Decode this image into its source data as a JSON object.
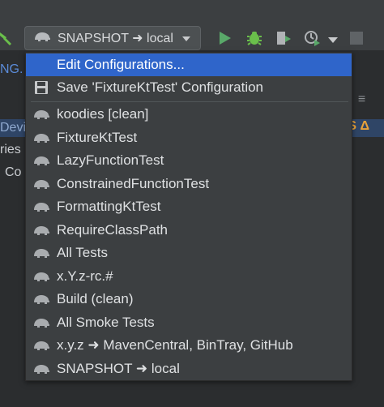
{
  "toolbar": {
    "config_selector_label": "SNAPSHOT ➜ local"
  },
  "background": {
    "tab_fragment": "NG.",
    "row1_fragment": "Devi",
    "row2_fragment": "ries",
    "row3_fragment": "Co",
    "delta_badge": "S Δ"
  },
  "menu": {
    "edit_configurations": "Edit Configurations...",
    "save_configuration": "Save 'FixtureKtTest' Configuration",
    "items": [
      "koodies [clean]",
      "FixtureKtTest",
      "LazyFunctionTest",
      "ConstrainedFunctionTest",
      "FormattingKtTest",
      "RequireClassPath",
      "All Tests",
      "x.Y.z-rc.#",
      "Build (clean)",
      "All Smoke Tests",
      "x.y.z ➜ MavenCentral, BinTray, GitHub",
      "SNAPSHOT ➜ local"
    ]
  },
  "colors": {
    "highlight": "#2f65ca",
    "run_green": "#59a869",
    "debug_green": "#6abf4b"
  }
}
